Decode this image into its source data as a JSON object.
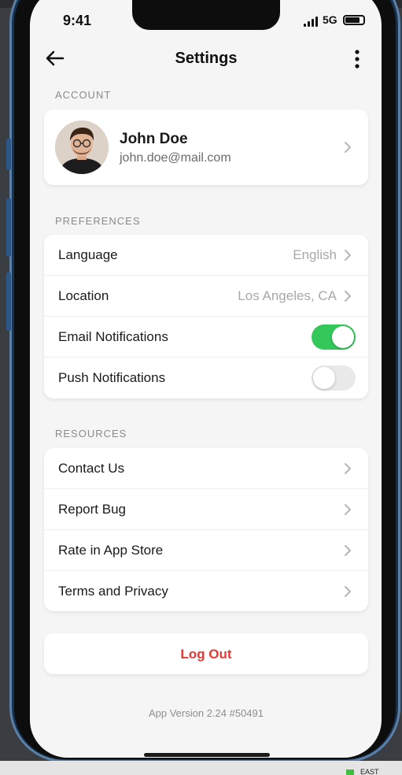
{
  "status_bar": {
    "time": "9:41",
    "network": "5G"
  },
  "nav": {
    "title": "Settings"
  },
  "account": {
    "section_label": "ACCOUNT",
    "name": "John Doe",
    "email": "john.doe@mail.com"
  },
  "preferences": {
    "section_label": "PREFERENCES",
    "language_label": "Language",
    "language_value": "English",
    "location_label": "Location",
    "location_value": "Los Angeles, CA",
    "email_notifications_label": "Email Notifications",
    "email_notifications_on": true,
    "push_notifications_label": "Push Notifications",
    "push_notifications_on": false
  },
  "resources": {
    "section_label": "RESOURCES",
    "items": [
      {
        "label": "Contact Us"
      },
      {
        "label": "Report Bug"
      },
      {
        "label": "Rate in App Store"
      },
      {
        "label": "Terms and Privacy"
      }
    ]
  },
  "logout": {
    "label": "Log Out"
  },
  "footer": {
    "version": "App Version 2.24 #50491"
  },
  "taskbar": {
    "label": "EAST"
  },
  "colors": {
    "toggle_on": "#34c759",
    "toggle_off": "#e9e9ea",
    "logout": "#e53935",
    "frame": "#17324f"
  },
  "icons": {
    "back": "arrow-left-icon",
    "more": "more-vertical-icon",
    "chevron": "chevron-right-icon",
    "signal": "signal-icon",
    "battery": "battery-icon"
  }
}
